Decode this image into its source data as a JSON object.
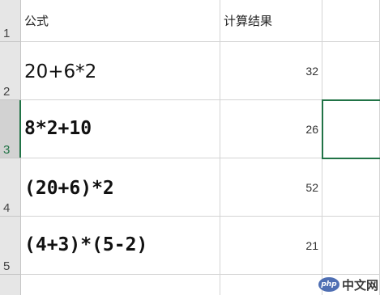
{
  "header": {
    "formula_col": "公式",
    "result_col": "计算结果",
    "row_label": "1"
  },
  "rows": [
    {
      "num": "2",
      "formula": "20+6*2",
      "result": "32"
    },
    {
      "num": "3",
      "formula": "8*2+10",
      "result": "26"
    },
    {
      "num": "4",
      "formula": "(20+6)*2",
      "result": "52"
    },
    {
      "num": "5",
      "formula": "(4+3)*(5-2)",
      "result": "21"
    }
  ],
  "selected_row": "3",
  "colors": {
    "selection": "#217346",
    "row_header_bg": "#e6e6e6",
    "gridline": "#d4d4d4"
  },
  "watermark": {
    "logo": "php",
    "text": "中文网"
  }
}
